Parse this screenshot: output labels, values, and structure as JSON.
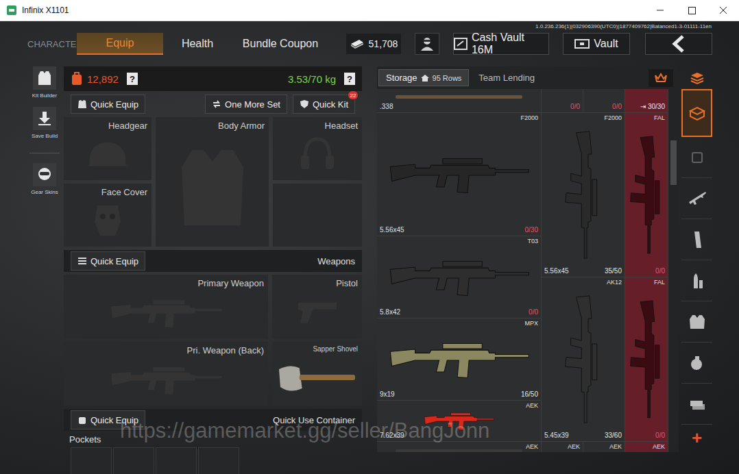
{
  "window": {
    "title": "Infinix X1101"
  },
  "version": "1.0.236.236(1)|032906390(UTC0)|1877409762|Balanced1-3-01111-11en",
  "nav": {
    "heading": "CHARACTER",
    "tabs": [
      {
        "label": "Equip",
        "selected": true
      },
      {
        "label": "Health",
        "selected": false
      },
      {
        "label": "Bundle Coupon",
        "selected": false
      }
    ],
    "currency": "51,708",
    "buttons": [
      {
        "label": "Cash Vault 16M",
        "kind": "cash-vault"
      },
      {
        "label": "Vault",
        "kind": "vault"
      }
    ]
  },
  "sideTools": [
    {
      "label": "Kit Builder",
      "kind": "kit"
    },
    {
      "label": "Save Build",
      "kind": "save"
    },
    {
      "label": "Gear Skins",
      "kind": "skins"
    }
  ],
  "equip": {
    "value": "12,892",
    "weight": "3.53/70 kg",
    "help": "?",
    "gearButtons": [
      {
        "label": "Quick Equip",
        "badge": ""
      },
      {
        "label": "One More Set",
        "badge": ""
      },
      {
        "label": "Quick Kit",
        "badge": "22"
      }
    ],
    "gearSlots": [
      {
        "label": "Headgear",
        "kind": "helmet"
      },
      {
        "label": "Body Armor",
        "kind": "armor"
      },
      {
        "label": "Headset",
        "kind": "headset"
      },
      {
        "label": "Face Cover",
        "kind": "mask"
      }
    ],
    "weaponsBar": {
      "button": "Quick Equip",
      "title": "Weapons"
    },
    "weaponSlots": [
      {
        "label": "Primary Weapon",
        "kind": "rifle",
        "filled": false
      },
      {
        "label": "Pistol",
        "kind": "pistol",
        "filled": false
      },
      {
        "label": "Pri. Weapon (Back)",
        "kind": "rifle-back",
        "filled": false
      },
      {
        "label": "Sapper Shovel",
        "kind": "shovel",
        "filled": true
      }
    ],
    "containerBar": {
      "button": "Quick Equip",
      "title": "Quick Use Container"
    },
    "pockets": {
      "label": "Pockets",
      "slots": [
        {
          "filled": false
        },
        {
          "filled": false
        },
        {
          "filled": false
        },
        {
          "filled": false
        }
      ]
    }
  },
  "storage": {
    "tabs": [
      {
        "label": "Storage",
        "rows": "95 Rows",
        "selected": true
      },
      {
        "label": "Team Lending",
        "rows": "",
        "selected": false
      }
    ],
    "columns": [
      {
        "kind": "flat",
        "blocked": false,
        "items": [
          {
            "kind": "stub",
            "name": "",
            "ammo": ".338",
            "count": "",
            "empty": false,
            "color": "#6b5238",
            "tag": ""
          },
          {
            "kind": "long",
            "name": "F2000",
            "ammo": "5.56x45",
            "count": "0/30",
            "empty": true,
            "color": "#262626",
            "tag": ""
          },
          {
            "kind": "mid",
            "name": "T03",
            "ammo": "5.8x42",
            "count": "0/0",
            "empty": true,
            "color": "#2e2e2e",
            "tag": ""
          },
          {
            "kind": "mid",
            "name": "MPX",
            "ammo": "9x19",
            "count": "16/50",
            "empty": false,
            "color": "#8b8760",
            "tag": ""
          },
          {
            "kind": "short",
            "name": "AEK",
            "ammo": "7.62x39",
            "count": "",
            "empty": false,
            "color": "#d8281c",
            "tag": ""
          },
          {
            "kind": "stub",
            "name": "AEK",
            "ammo": "",
            "count": "",
            "empty": false,
            "color": "#3a3a3a",
            "tag": ""
          }
        ]
      },
      {
        "kind": "upright",
        "blocked": false,
        "items": [
          {
            "kind": "stub",
            "name": "",
            "ammo": "",
            "count": "0/0",
            "empty": true,
            "color": "",
            "tag": "",
            "pair": {
              "name": "",
              "ammo": "",
              "count": "0/0",
              "empty": true,
              "color": "",
              "tag": ""
            }
          },
          {
            "kind": "tall",
            "name": "F2000",
            "ammo": "5.56x45",
            "count": "35/50",
            "empty": false,
            "color": "#2a2a2a",
            "tag": ""
          },
          {
            "kind": "tall",
            "name": "AK12",
            "ammo": "5.45x39",
            "count": "33/60",
            "empty": false,
            "color": "#2f2f2f",
            "tag": ""
          },
          {
            "kind": "stub",
            "name": "AEK",
            "ammo": "",
            "count": "",
            "empty": false,
            "color": "",
            "tag": "",
            "pair": {
              "name": "AEK",
              "ammo": "",
              "count": "",
              "empty": false,
              "color": "",
              "tag": ""
            }
          }
        ]
      },
      {
        "kind": "upright",
        "blocked": true,
        "items": [
          {
            "kind": "stub",
            "name": "",
            "ammo": "",
            "count": "30/30",
            "empty": false,
            "color": "",
            "tag": "⇥"
          },
          {
            "kind": "tall",
            "name": "FAL",
            "ammo": "",
            "count": "0/0",
            "empty": true,
            "color": "#3a0c12",
            "tag": ""
          },
          {
            "kind": "tall",
            "name": "FAL",
            "ammo": "",
            "count": "0/0",
            "empty": true,
            "color": "#3a0c12",
            "tag": ""
          },
          {
            "kind": "stub",
            "name": "AEK",
            "ammo": "",
            "count": "",
            "empty": false,
            "color": "",
            "tag": ""
          }
        ]
      }
    ]
  },
  "categories": [
    {
      "kind": "storage",
      "selected": true
    },
    {
      "kind": "misc",
      "selected": false
    },
    {
      "kind": "rifle",
      "selected": false
    },
    {
      "kind": "magazine",
      "selected": false
    },
    {
      "kind": "ammo",
      "selected": false
    },
    {
      "kind": "armor",
      "selected": false
    },
    {
      "kind": "grenade",
      "selected": false
    },
    {
      "kind": "cash",
      "selected": false
    }
  ],
  "addLabel": "+",
  "watermark": "https://gamemarket.gg/seller/BangJonn"
}
